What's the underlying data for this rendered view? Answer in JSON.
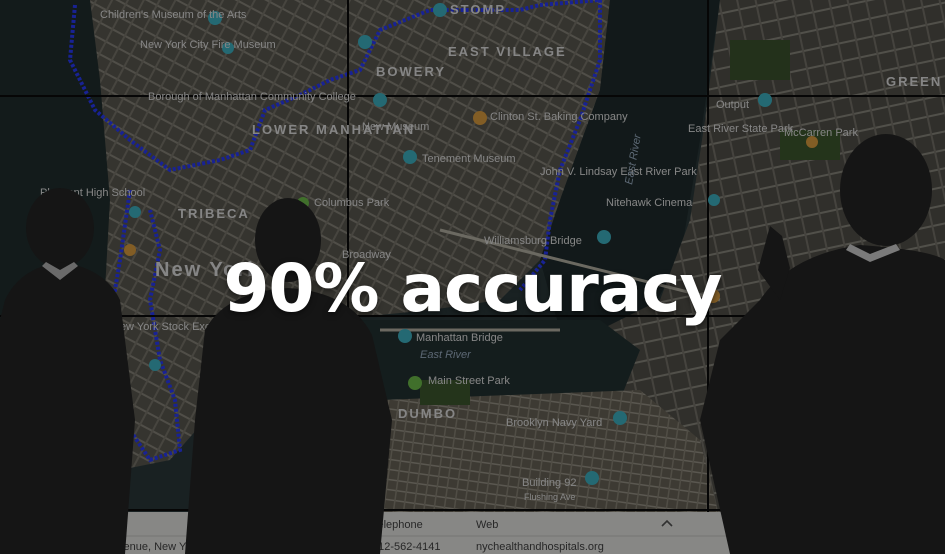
{
  "headline": "90% accuracy",
  "map_labels": {
    "childrens_museum": "Children's Museum of the Arts",
    "ny_city_fire_museum": "New York City Fire Museum",
    "stomp": "STOMP",
    "east_village": "EAST VILLAGE",
    "bowery": "BOWERY",
    "borough_college": "Borough of Manhattan Community College",
    "lower_manhattan": "LOWER MANHATTAN",
    "new_museum": "New Museum",
    "clinton_st_baking": "Clinton St. Baking Company",
    "tenement_museum": "Tenement Museum",
    "john_lindsay_park": "John V. Lindsay East River Park",
    "east_river_vertical": "East River",
    "output": "Output",
    "east_river_state_park": "East River State Park",
    "mccarren_park": "McCarren Park",
    "greenpoint": "GREEN",
    "high_school": "Pleasant High School",
    "tribeca": "TRIBECA",
    "columbus_park": "Columbus Park",
    "nitehawk": "Nitehawk Cinema",
    "williamsburg_bridge": "Williamsburg Bridge",
    "broadway": "Broadway",
    "new_york": "New York",
    "ny_stock_exchange": "New York Stock Exchange",
    "manhattan_bridge": "Manhattan Bridge",
    "east_river": "East River",
    "main_street_park": "Main Street Park",
    "dumbo": "DUMBO",
    "brooklyn_navy_yard": "Brooklyn Navy Yard",
    "building_92": "Building 92",
    "flushing_ave": "Flushing Ave"
  },
  "info_panel": {
    "telephone_header": "Telephone",
    "web_header": "Web",
    "address": "venue, New York",
    "phone": "212-562-4141",
    "website": "nychealthandhospitals.org"
  },
  "colors": {
    "overlay": "#000000",
    "boundary": "#2a3cff",
    "pin_teal": "#3fb6c6",
    "pin_orange": "#e0a040",
    "pin_green": "#6fbf4a"
  },
  "icons": [
    "map-pin-icon",
    "chevron-up-icon"
  ]
}
